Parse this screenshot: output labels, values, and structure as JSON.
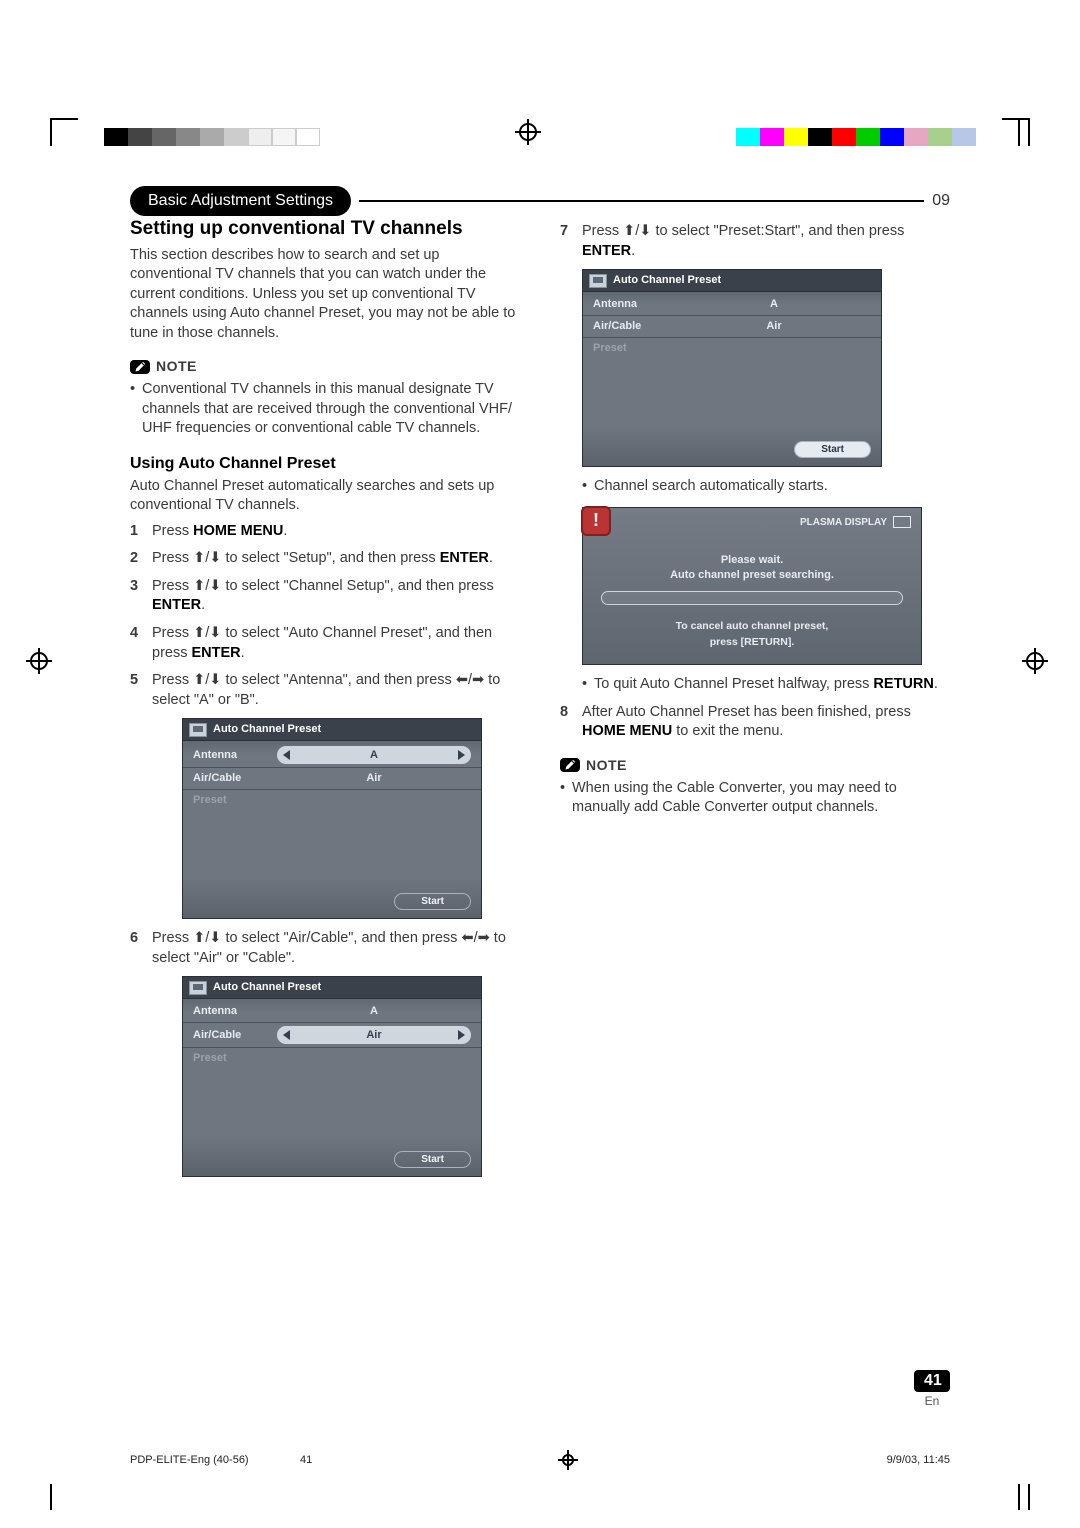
{
  "chapter": {
    "title": "Basic Adjustment Settings",
    "number": "09"
  },
  "section": {
    "title": "Setting up conventional TV channels",
    "intro": "This section describes how to search and set up conventional TV channels that you can watch under the current conditions. Unless you set up conventional TV channels using Auto channel Preset, you may not be able to tune in those channels."
  },
  "note1": {
    "label": "NOTE",
    "text": "Conventional TV channels in this manual designate TV channels that are received through the conventional VHF/ UHF frequencies or conventional cable TV channels."
  },
  "sub": {
    "title": "Using Auto Channel Preset",
    "intro": "Auto Channel Preset automatically searches and sets up conventional TV channels."
  },
  "steps": {
    "s1a": "Press ",
    "s1b": "HOME MENU",
    "s1c": ".",
    "s2a": "Press ",
    "s2b": " to select \"Setup\", and then press ",
    "s2c": "ENTER",
    "s2d": ".",
    "s3a": "Press ",
    "s3b": " to select \"Channel Setup\", and then press ",
    "s3c": "ENTER",
    "s3d": ".",
    "s4a": "Press ",
    "s4b": " to select \"Auto Channel Preset\", and then press ",
    "s4c": "ENTER",
    "s4d": ".",
    "s5a": "Press ",
    "s5b": " to select \"Antenna\", and then press ",
    "s5c": " to select \"A\" or \"B\".",
    "s6a": "Press ",
    "s6b": " to select \"Air/Cable\", and then press ",
    "s6c": " to select \"Air\" or \"Cable\".",
    "s7a": "Press ",
    "s7b": " to select \"Preset:Start\", and then press ",
    "s7c": "ENTER",
    "s7d": "."
  },
  "post7": {
    "bullet1": "Channel search automatically starts.",
    "bullet2a": "To quit Auto Channel Preset halfway, press ",
    "bullet2b": "RETURN",
    "bullet2c": "."
  },
  "step8": {
    "a": "After Auto Channel Preset has been finished, press ",
    "b": "HOME MENU",
    "c": " to exit the menu."
  },
  "note2": {
    "label": "NOTE",
    "text": "When using the Cable Converter, you may need to manually add Cable Converter output channels."
  },
  "osd": {
    "title": "Auto Channel Preset",
    "antenna_k": "Antenna",
    "antenna_v": "A",
    "aircable_k": "Air/Cable",
    "aircable_v": "Air",
    "preset_k": "Preset",
    "start": "Start"
  },
  "dlg": {
    "brand": "PLASMA DISPLAY",
    "line1": "Please wait.",
    "line2": "Auto channel preset searching.",
    "cancel1": "To cancel auto channel preset,",
    "cancel2": "press [RETURN]."
  },
  "page": {
    "num": "41",
    "lang": "En"
  },
  "printfoot": {
    "file": "PDP-ELITE-Eng (40-56)",
    "pg": "41",
    "ts": "9/9/03, 11:45"
  },
  "arrows": {
    "ud": "⬆/⬇",
    "lr": "⬅/➡"
  }
}
